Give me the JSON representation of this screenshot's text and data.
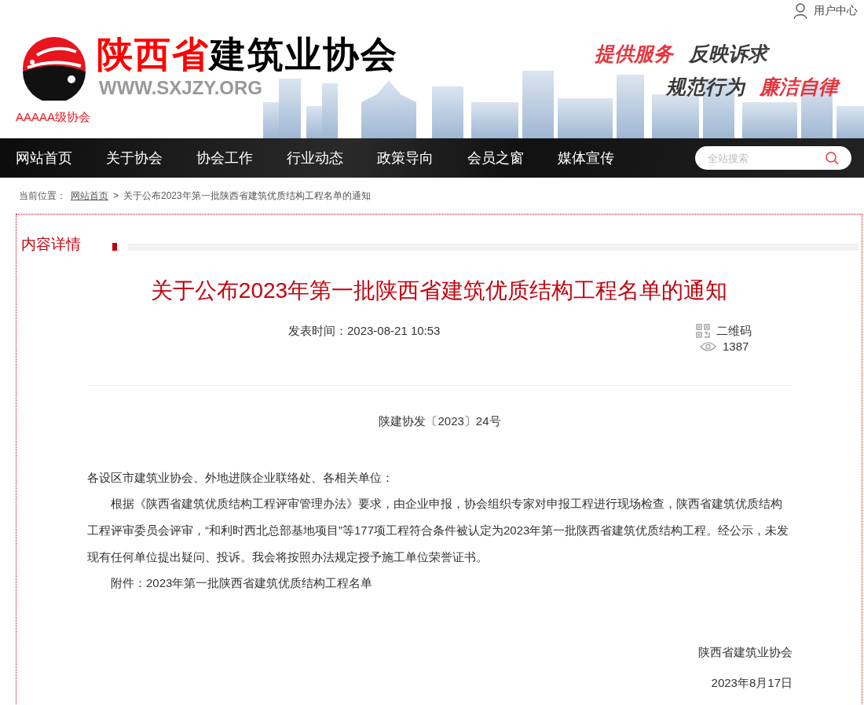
{
  "top_bar": {
    "user_center": "用户中心"
  },
  "header": {
    "logo_red": "陕西省",
    "logo_black": "建筑业协会",
    "url": "WWW.SXJZY.ORG",
    "grade": "AAAAA级协会",
    "slogans": [
      {
        "text": "提供服务",
        "color": "#e8333c"
      },
      {
        "text": "反映诉求",
        "color": "#3a3a3a"
      },
      {
        "text": "规范行为",
        "color": "#3a3a3a"
      },
      {
        "text": "廉洁自律",
        "color": "#e8333c"
      }
    ]
  },
  "nav": {
    "items": [
      {
        "label": "网站首页",
        "selected": false
      },
      {
        "label": "关于协会",
        "selected": false
      },
      {
        "label": "协会工作",
        "selected": false
      },
      {
        "label": "行业动态",
        "selected": false
      },
      {
        "label": "政策导向",
        "selected": false
      },
      {
        "label": "会员之窗",
        "selected": false
      },
      {
        "label": "媒体宣传",
        "selected": false
      }
    ],
    "search": {
      "placeholder": "全站搜索"
    }
  },
  "breadcrumb": {
    "label": "当前位置：",
    "home": "网站首页",
    "separator": ">",
    "current": "关于公布2023年第一批陕西省建筑优质结构工程名单的通知"
  },
  "article": {
    "section_title": "内容详情",
    "title": "关于公布2023年第一批陕西省建筑优质结构工程名单的通知",
    "published": "发表时间：2023-08-21 10:53",
    "qr_label": "二维码",
    "views": "1387",
    "doc_number": "陕建协发〔2023〕24号",
    "salutation": "各设区市建筑业协会、外地进陕企业联络处、各相关单位：",
    "paragraphs": [
      "根据《陕西省建筑优质结构工程评审管理办法》要求，由企业申报，协会组织专家对申报工程进行现场检查，陕西省建筑优质结构工程评审委员会评审，“和利时西北总部基地项目”等177项工程符合条件被认定为2023年第一批陕西省建筑优质结构工程。经公示，未发现有任何单位提出疑问、投诉。我会将按照办法规定授予施工单位荣誉证书。",
      "附件：2023年第一批陕西省建筑优质结构工程名单"
    ],
    "signature": "陕西省建筑业协会",
    "date": "2023年8月17日"
  }
}
